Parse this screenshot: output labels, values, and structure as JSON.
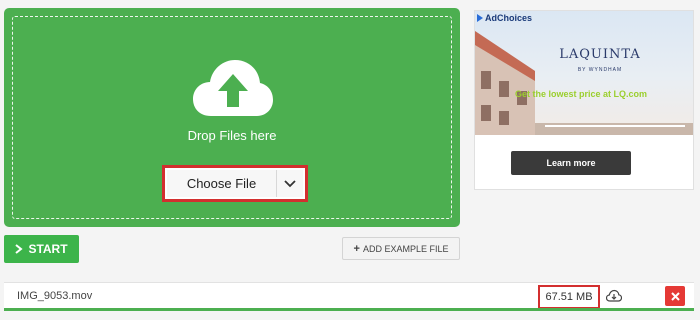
{
  "dropzone": {
    "drop_text": "Drop Files here",
    "choose_label": "Choose File"
  },
  "ad": {
    "adchoices_label": "AdChoices",
    "brand": "LAQUINTA",
    "brand_sub": "BY WYNDHAM",
    "tagline": "Get the lowest price at LQ.com",
    "cta_label": "Learn more"
  },
  "actions": {
    "start_label": "START",
    "add_example_label": "ADD EXAMPLE FILE"
  },
  "file": {
    "name": "IMG_9053.mov",
    "size": "67.51 MB",
    "progress": 1.0
  },
  "colors": {
    "accent_green": "#4caf50",
    "highlight_red": "#d32f2f",
    "delete_red": "#e53935",
    "ad_tagline": "#9bcf2e"
  },
  "icons": {
    "upload": "cloud-upload-arrow-icon",
    "dropdown": "chevron-down-icon",
    "start": "chevron-right-icon",
    "add": "plus-icon",
    "save_cloud": "cloud-save-icon",
    "remove": "close-icon",
    "adchoices": "adchoices-icon"
  }
}
